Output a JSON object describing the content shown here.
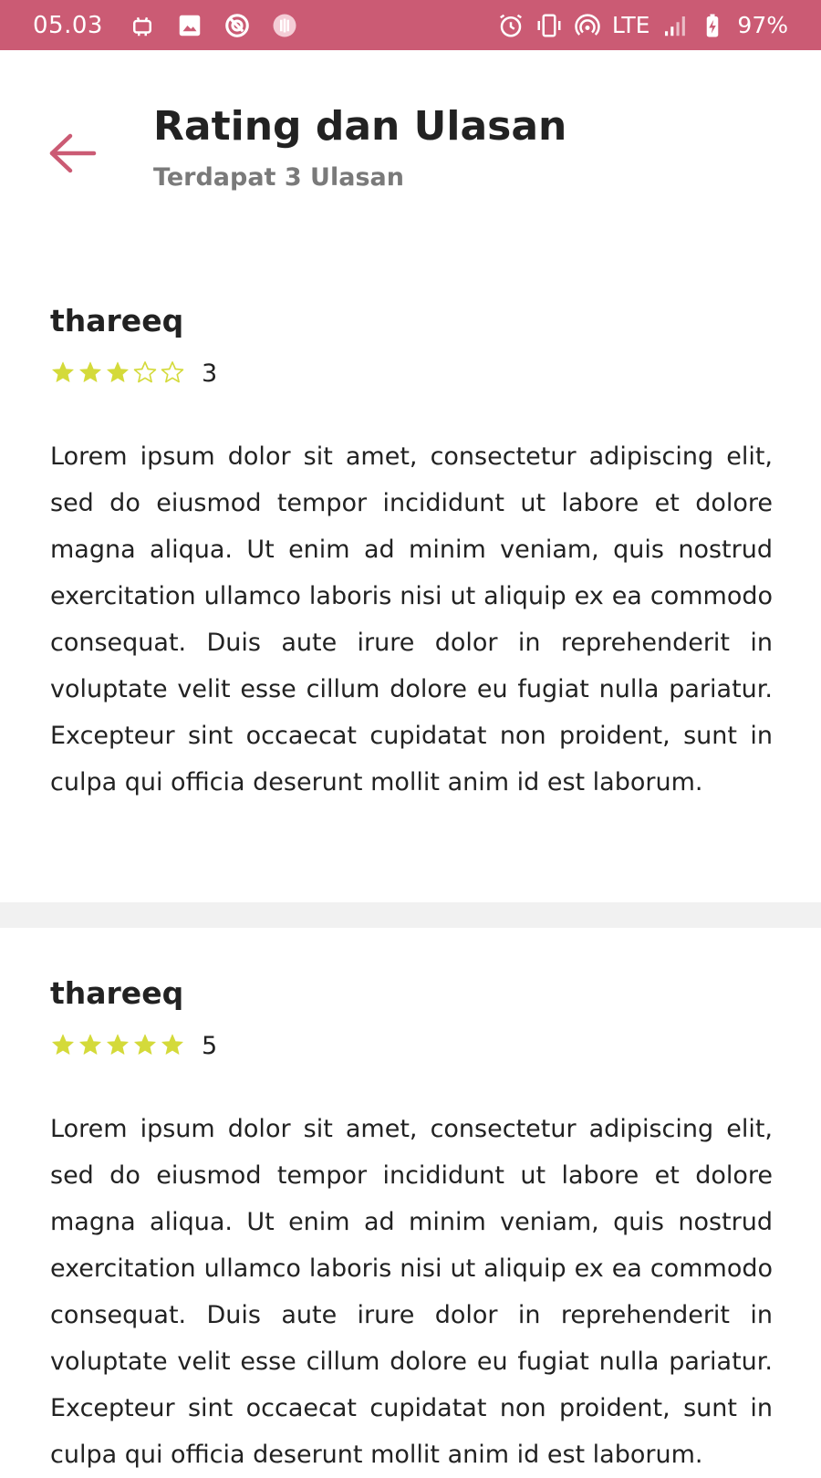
{
  "status_bar": {
    "time": "05.03",
    "network": "LTE",
    "battery": "97%",
    "icons_left": [
      "android-icon",
      "image-icon",
      "vpn-icon",
      "app-icon"
    ],
    "icons_right": [
      "alarm-icon",
      "vibrate-icon",
      "hotspot-icon",
      "signal-icon",
      "battery-icon"
    ]
  },
  "header": {
    "title": "Rating dan Ulasan",
    "subtitle": "Terdapat 3 Ulasan",
    "back_icon": "arrow-left-icon"
  },
  "colors": {
    "accent": "#cb5b74",
    "star": "#d4da3a",
    "text": "#222222",
    "subtext": "#7a7a7a",
    "divider": "#f1f1f1"
  },
  "reviews": [
    {
      "name": "thareeq",
      "rating": 3,
      "rating_label": "3",
      "text": "Lorem ipsum dolor sit amet, consectetur adipiscing elit, sed do eiusmod tempor incididunt ut labore et dolore magna aliqua. Ut enim ad minim veniam, quis nostrud exercitation ullamco laboris nisi ut aliquip ex ea commodo consequat. Duis aute irure dolor in reprehenderit in voluptate velit esse cillum dolore eu fugiat nulla pariatur. Excepteur sint occaecat cupidatat non proident, sunt in culpa qui officia deserunt mollit anim id est laborum."
    },
    {
      "name": "thareeq",
      "rating": 5,
      "rating_label": "5",
      "text": "Lorem ipsum dolor sit amet, consectetur adipiscing elit, sed do eiusmod tempor incididunt ut labore et dolore magna aliqua. Ut enim ad minim veniam, quis nostrud exercitation ullamco laboris nisi ut aliquip ex ea commodo consequat. Duis aute irure dolor in reprehenderit in voluptate velit esse cillum dolore eu fugiat nulla pariatur. Excepteur sint occaecat cupidatat non proident, sunt in culpa qui officia deserunt mollit anim id est laborum."
    }
  ],
  "max_rating": 5
}
